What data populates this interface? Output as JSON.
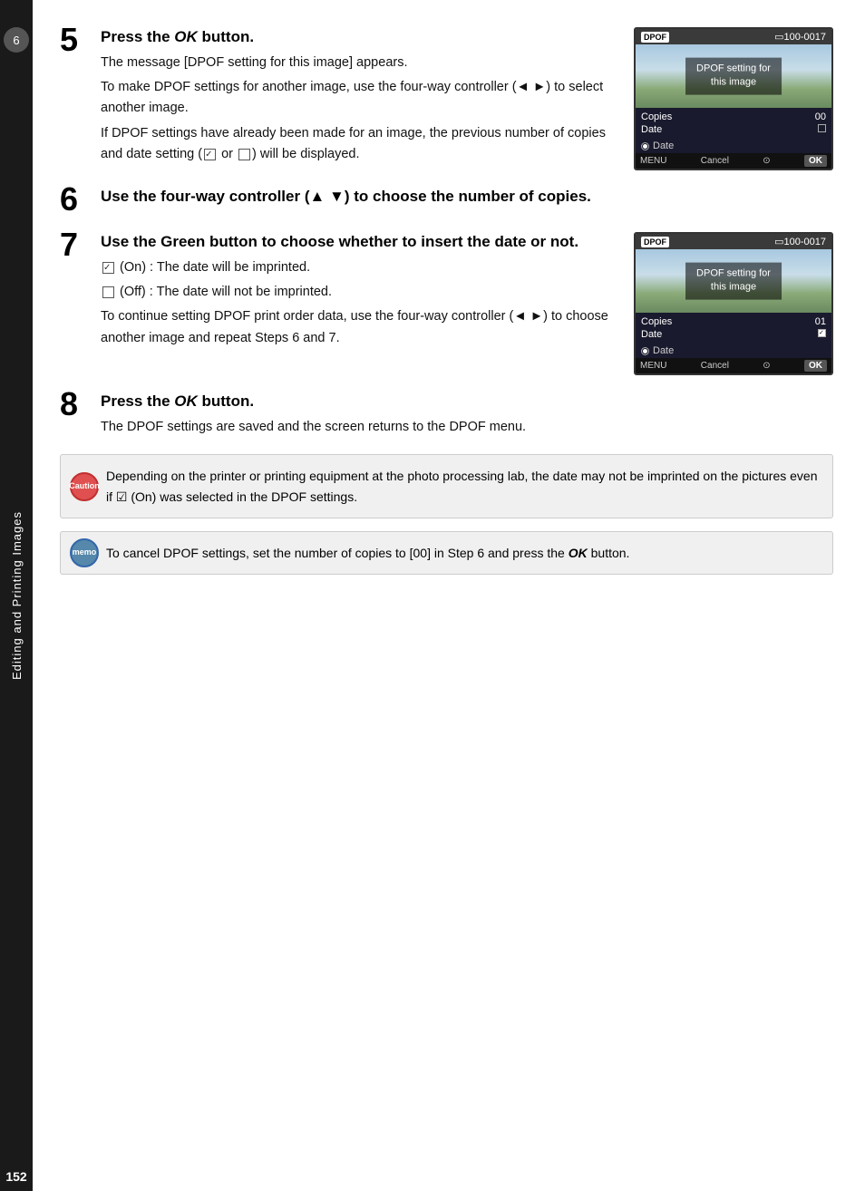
{
  "sidebar": {
    "chapter_number": "6",
    "chapter_label": "Editing and Printing Images",
    "page_number": "152"
  },
  "steps": {
    "step5": {
      "number": "5",
      "title_prefix": "Press the ",
      "title_ok": "OK",
      "title_suffix": " button.",
      "body_lines": [
        "The message [DPOF setting for this image]",
        "appears.",
        "To make DPOF settings for another image,",
        "use the four-way controller (◄ ►) to select",
        "another image.",
        "If DPOF settings have already been made",
        "for an image, the previous number of copies and date setting (☑ or □)",
        "will be displayed."
      ]
    },
    "step6": {
      "number": "6",
      "title": "Use the four-way controller (▲ ▼) to choose the number of copies."
    },
    "step7": {
      "number": "7",
      "title": "Use the Green button to choose whether to insert the date or not.",
      "body_lines": [
        "☑ (On) :  The date will be imprinted.",
        "□ (Off) :  The date will not be imprinted.",
        "To continue setting DPOF print order data,",
        "use the four-way controller (◄ ►) to choose",
        "another image and repeat Steps 6 and 7."
      ]
    },
    "step8": {
      "number": "8",
      "title_prefix": "Press the ",
      "title_ok": "OK",
      "title_suffix": " button.",
      "body": "The DPOF settings are saved and the screen returns to the DPOF menu."
    }
  },
  "camera_screen_1": {
    "top_label": "100-0017",
    "overlay_line1": "DPOF setting for",
    "overlay_line2": "this image",
    "copies_label": "Copies",
    "copies_value": "00",
    "date_label": "Date",
    "date_value": "",
    "menu_label": "MENU",
    "cancel_label": "Cancel",
    "ok_label": "OK"
  },
  "camera_screen_2": {
    "top_label": "100-0017",
    "overlay_line1": "DPOF setting for",
    "overlay_line2": "this image",
    "copies_label": "Copies",
    "copies_value": "01",
    "date_label": "Date",
    "date_checked": true,
    "menu_label": "MENU",
    "cancel_label": "Cancel",
    "ok_label": "OK"
  },
  "notes": {
    "caution": {
      "icon_label": "Caution",
      "text": "Depending on the printer or printing equipment at the photo processing lab, the date may not be imprinted on the pictures even if ☑ (On) was selected in the DPOF settings."
    },
    "memo": {
      "icon_label": "memo",
      "text_prefix": "To cancel DPOF settings, set the number of copies to [00] in Step 6 and press the ",
      "text_ok": "OK",
      "text_suffix": " button."
    }
  }
}
